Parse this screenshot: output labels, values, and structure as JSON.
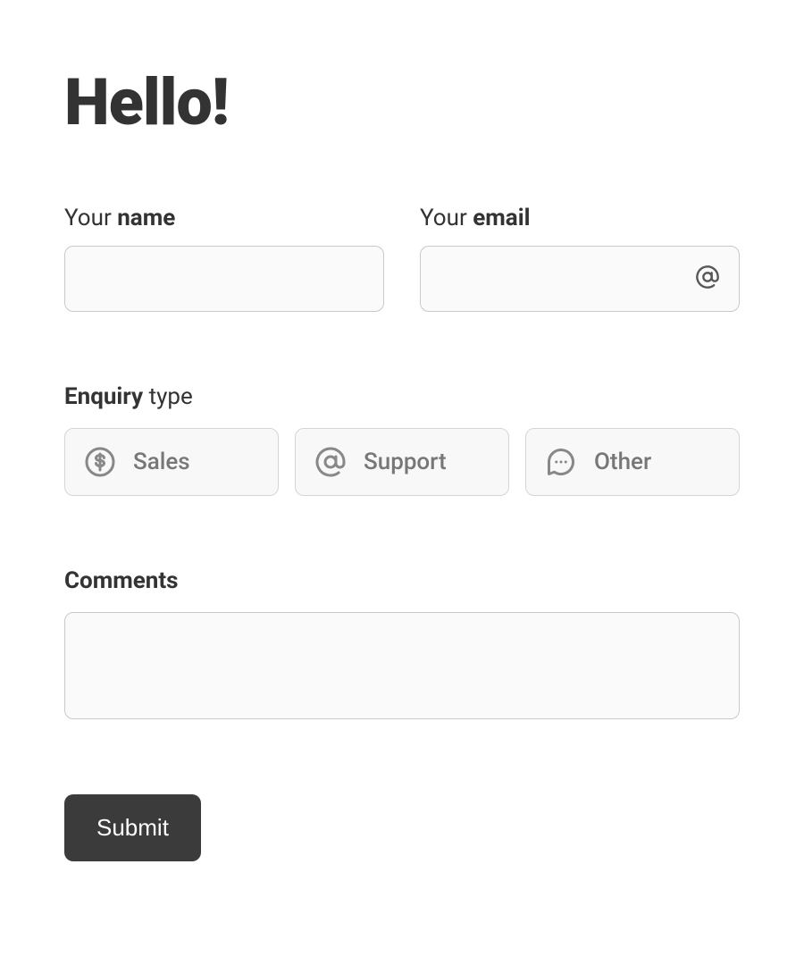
{
  "title": "Hello!",
  "name_field": {
    "label_prefix": "Your ",
    "label_bold": "name",
    "value": ""
  },
  "email_field": {
    "label_prefix": "Your ",
    "label_bold": "email",
    "value": "",
    "icon": "at-sign-icon"
  },
  "enquiry": {
    "label_bold": "Enquiry",
    "label_suffix": " type",
    "options": [
      {
        "label": "Sales",
        "icon": "dollar-circle-icon"
      },
      {
        "label": "Support",
        "icon": "at-sign-icon"
      },
      {
        "label": "Other",
        "icon": "chat-bubble-icon"
      }
    ]
  },
  "comments": {
    "label": "Comments",
    "value": ""
  },
  "submit_label": "Submit"
}
